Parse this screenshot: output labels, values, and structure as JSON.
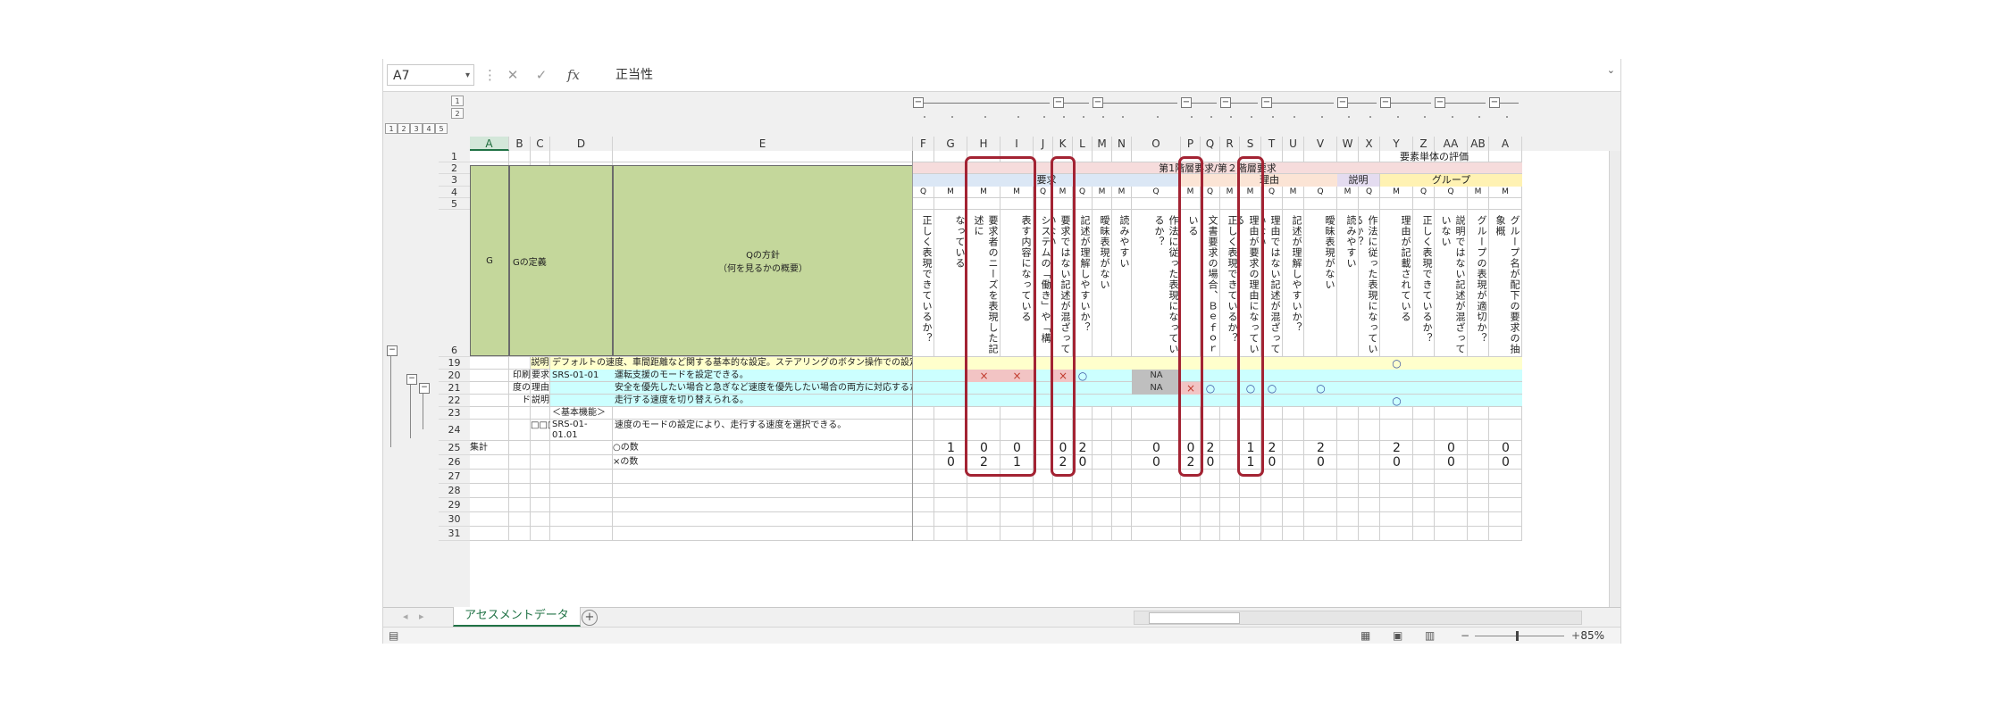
{
  "formula_bar": {
    "name_box": "A7",
    "fx_label": "fx",
    "cancel": "✕",
    "enter": "✓",
    "value": "正当性"
  },
  "outline_levels": {
    "col": [
      "1",
      "2"
    ],
    "row": [
      "1",
      "2",
      "3",
      "4",
      "5"
    ]
  },
  "columns": [
    "A",
    "B",
    "C",
    "D",
    "E",
    "F",
    "G",
    "H",
    "I",
    "J",
    "K",
    "L",
    "M",
    "N",
    "O",
    "P",
    "Q",
    "R",
    "S",
    "T",
    "U",
    "V",
    "W",
    "X",
    "Y",
    "Z",
    "AA",
    "AB",
    "A"
  ],
  "row_numbers": [
    "1",
    "2",
    "3",
    "4",
    "5",
    "6",
    "19",
    "20",
    "21",
    "22",
    "23",
    "24",
    "25",
    "26",
    "27",
    "28",
    "29",
    "30",
    "31"
  ],
  "header_top": "要素単体の評価",
  "header_level1": "第1階層要求/第２階層要求",
  "section_labels": {
    "yokyu": "要求",
    "riyu": "理由",
    "setsumei": "説明",
    "group": "グループ"
  },
  "qm_row": [
    "Q",
    "M",
    "M",
    "M",
    "Q",
    "M",
    "Q",
    "M",
    "M",
    "Q",
    "M",
    "Q",
    "M",
    "M",
    "Q",
    "M",
    "Q",
    "M",
    "Q",
    "M",
    "Q",
    "Q",
    "M",
    "M"
  ],
  "big_header": {
    "g": "G",
    "g_def": "Gの定義",
    "q_policy": "Qの方針\n（何を見るかの概要）"
  },
  "vertical_headers": [
    "正しく表現できているか？",
    "なっている",
    "要求者のニーズを表現した記述に",
    "表す内容になっている",
    "システムの「働き」や「構成」を",
    "要求ではない記述が混ざっていない",
    "記述が理解しやすいか？",
    "曖昧表現がない",
    "読みやすい",
    "作法に従った表現になっているか？",
    "いる",
    "文書要求の場合、Ｂｅｆｏｒｅ、",
    "正しく表現できているか？",
    "理由が要求の理由になっている",
    "理由ではない記述が混ざっていない",
    "記述が理解しやすいか？",
    "曖昧表現がない",
    "読みやすい",
    "作法に従った表現になっているか？",
    "理由が記載されている",
    "正しく表現できているか？",
    "説明ではない記述が混ざっていない",
    "グループの表現が適切か？",
    "グループ名が配下の要求の抽象概"
  ],
  "rows": {
    "r19": {
      "c": "説明",
      "de": "デフォルトの速度、車間距離など関する基本的な設定。ステアリングのボタン操作での設定項目が該"
    },
    "r20": {
      "b": "印刷速",
      "c": "要求",
      "d": "SRS-01-01",
      "e": "運転支援のモードを設定できる。"
    },
    "r21": {
      "b": "度のモー",
      "c": "理由",
      "e": "安全を優先したい場合と急ぎなど速度を優先したい場合の両方に対応するため。"
    },
    "r22": {
      "b": "ド",
      "c": "説明",
      "e": "走行する速度を切り替えられる。"
    },
    "r23": {
      "d": "＜基本機能＞"
    },
    "r24": {
      "c": "□□□",
      "d": "SRS-01-01.01",
      "e": "速度のモードの設定により、走行する速度を選択できる。"
    },
    "r25": {
      "a": "集計",
      "e": "○の数"
    },
    "r26": {
      "e": "×の数"
    }
  },
  "marks": {
    "x": "×",
    "o": "○",
    "na": "NA"
  },
  "counts_o": [
    "1",
    "0",
    "0",
    "0",
    "2",
    "0",
    "0",
    "2",
    "1",
    "2",
    "2",
    "2",
    "0",
    "0"
  ],
  "counts_x": [
    "0",
    "2",
    "1",
    "2",
    "0",
    "0",
    "2",
    "0",
    "1",
    "0",
    "0",
    "0",
    "0",
    "0"
  ],
  "sheet_tab": "アセスメントデータ",
  "add_sheet": "+",
  "zoom": "85%",
  "colors": {
    "green_fill": "#c4d79b",
    "cyan_fill": "#ccffff",
    "yellow_fill": "#ffffcc",
    "highlight_red": "#a32333"
  }
}
